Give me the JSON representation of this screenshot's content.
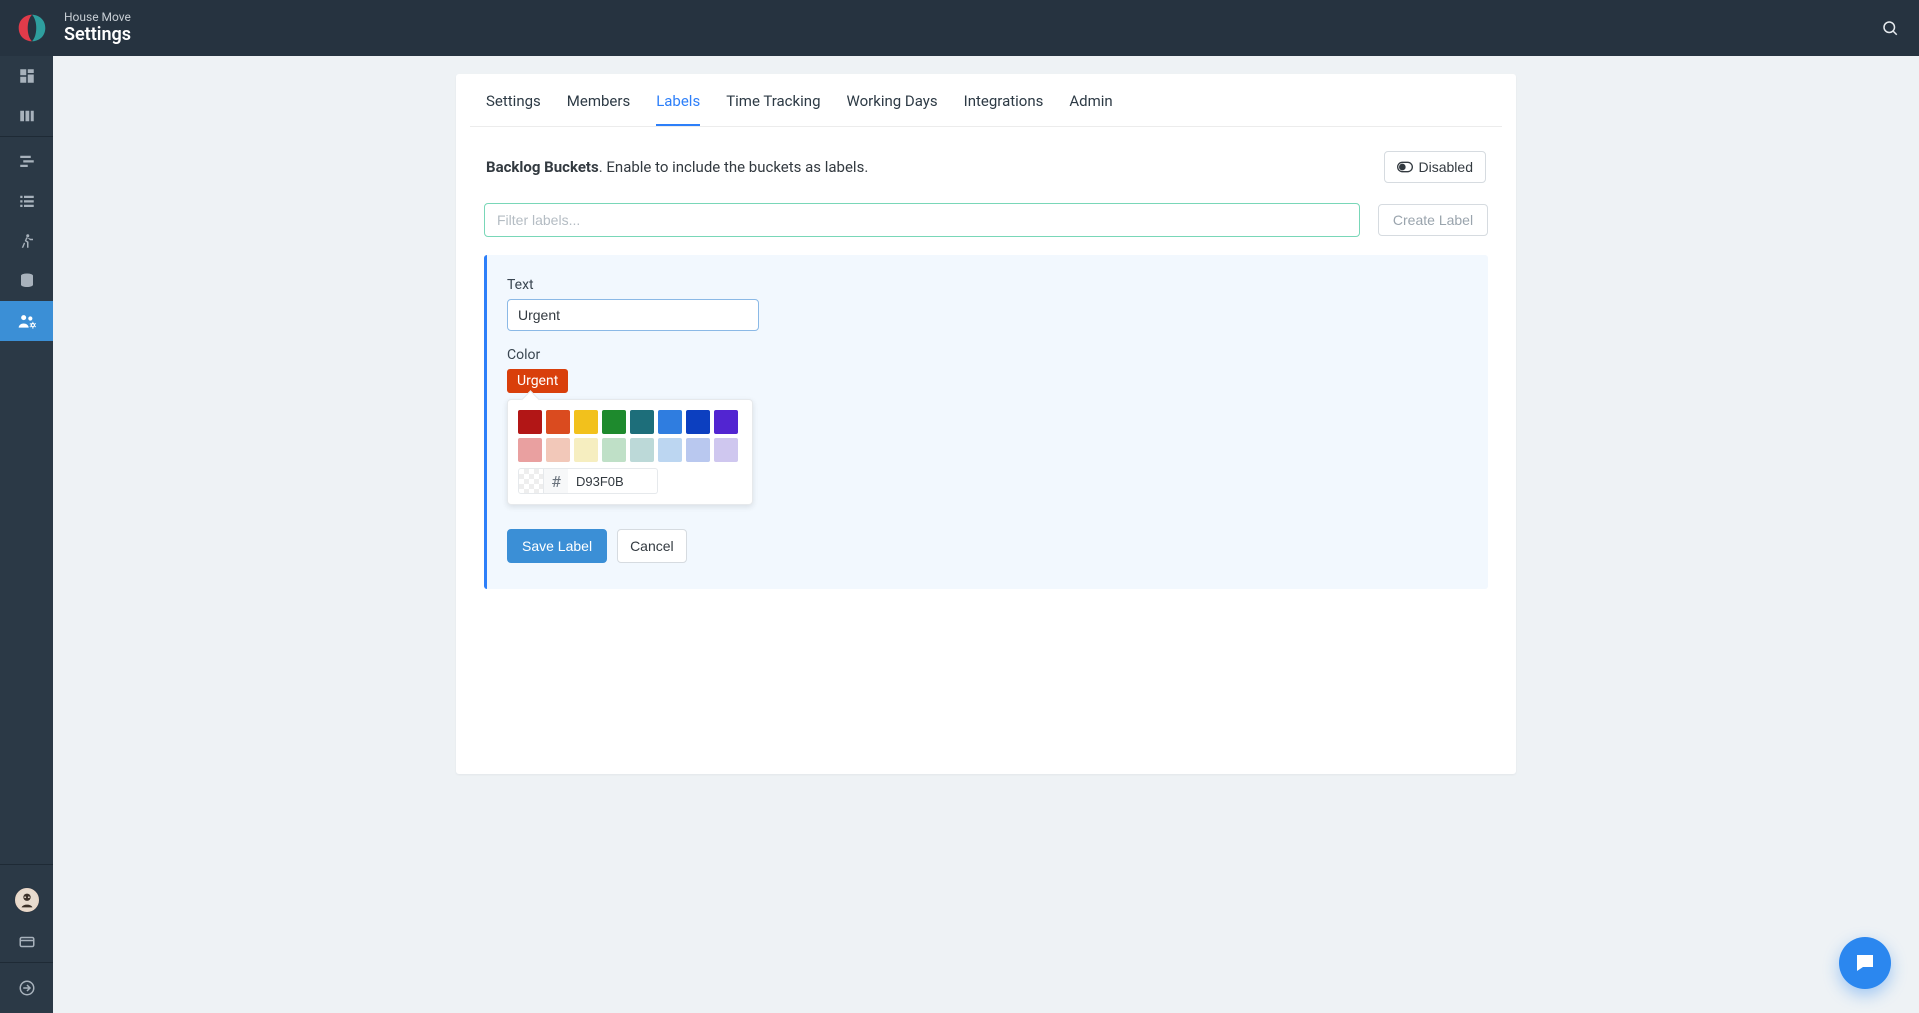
{
  "header": {
    "project": "House Move",
    "page": "Settings"
  },
  "tabs": [
    {
      "label": "Settings"
    },
    {
      "label": "Members"
    },
    {
      "label": "Labels",
      "active": true
    },
    {
      "label": "Time Tracking"
    },
    {
      "label": "Working Days"
    },
    {
      "label": "Integrations"
    },
    {
      "label": "Admin"
    }
  ],
  "backlog": {
    "title": "Backlog Buckets",
    "desc": ". Enable to include the buckets as labels.",
    "buttonLabel": "Disabled"
  },
  "filter": {
    "placeholder": "Filter labels...",
    "createLabel": "Create Label"
  },
  "editor": {
    "textLabel": "Text",
    "textValue": "Urgent",
    "colorLabel": "Color",
    "previewText": "Urgent",
    "previewColor": "#D93F0B",
    "hexValue": "D93F0B",
    "saveLabel": "Save Label",
    "cancelLabel": "Cancel",
    "swatchesTop": [
      "#b21616",
      "#da4b1f",
      "#f2c11c",
      "#1e8a2d",
      "#1d6e7a",
      "#2f7de0",
      "#0c3fc0",
      "#5225d1"
    ],
    "swatchesBottom": [
      "#e9a0a0",
      "#f2c8b9",
      "#f6eec0",
      "#bfe0c7",
      "#bcd9d8",
      "#bcd6f1",
      "#b9c8ef",
      "#cfc7ef"
    ]
  }
}
